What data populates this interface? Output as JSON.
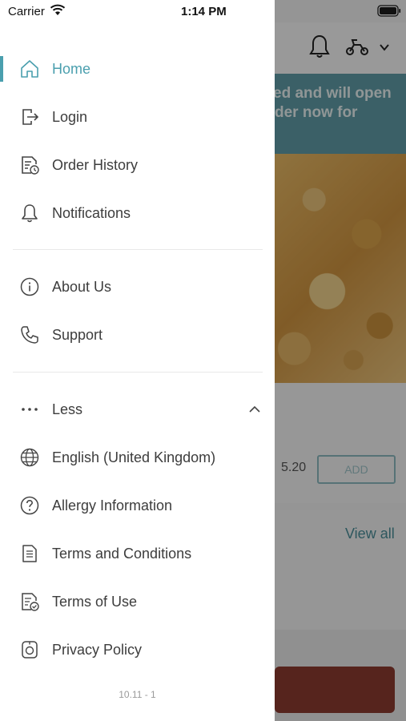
{
  "status_bar": {
    "carrier": "Carrier",
    "time": "1:14 PM"
  },
  "colors": {
    "accent": "#4a9fae",
    "banner": "#5f9ca6",
    "checkout": "#8c3a30"
  },
  "background": {
    "banner_line_1": "ed and will open",
    "banner_line_2": "der now for",
    "price": "5.20",
    "add_label": "ADD",
    "view_all_label": "View all"
  },
  "menu": {
    "primary": [
      {
        "label": "Home",
        "icon": "home-icon",
        "active": true
      },
      {
        "label": "Login",
        "icon": "login-icon"
      },
      {
        "label": "Order History",
        "icon": "order-history-icon"
      },
      {
        "label": "Notifications",
        "icon": "bell-icon"
      }
    ],
    "secondary": [
      {
        "label": "About Us",
        "icon": "info-icon"
      },
      {
        "label": "Support",
        "icon": "phone-icon"
      }
    ],
    "more": {
      "label": "Less",
      "icon": "more-dots-icon",
      "expanded": true
    },
    "extra": [
      {
        "label": "English (United Kingdom)",
        "icon": "globe-icon"
      },
      {
        "label": "Allergy Information",
        "icon": "question-circle-icon"
      },
      {
        "label": "Terms and Conditions",
        "icon": "document-icon"
      },
      {
        "label": "Terms of Use",
        "icon": "document-check-icon"
      },
      {
        "label": "Privacy Policy",
        "icon": "privacy-icon"
      }
    ]
  },
  "version": "10.11 - 1"
}
